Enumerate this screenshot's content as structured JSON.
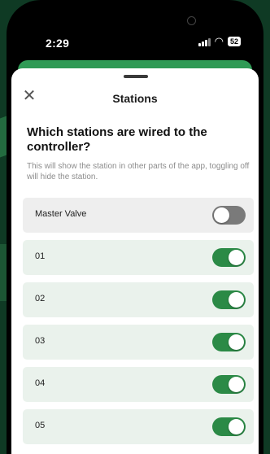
{
  "status_bar": {
    "time": "2:29",
    "battery": "52"
  },
  "sheet": {
    "title": "Stations",
    "question": "Which stations are wired to the controller?",
    "description": "This will show the station in other parts of the app, toggling off will hide the station."
  },
  "stations": [
    {
      "label": "Master Valve",
      "enabled": false
    },
    {
      "label": "01",
      "enabled": true
    },
    {
      "label": "02",
      "enabled": true
    },
    {
      "label": "03",
      "enabled": true
    },
    {
      "label": "04",
      "enabled": true
    },
    {
      "label": "05",
      "enabled": true
    }
  ],
  "colors": {
    "toggle_on": "#2b8a46",
    "toggle_off": "#7a7a7a",
    "row_background": "#eaf2ec",
    "brand_green": "#2f9a55"
  }
}
